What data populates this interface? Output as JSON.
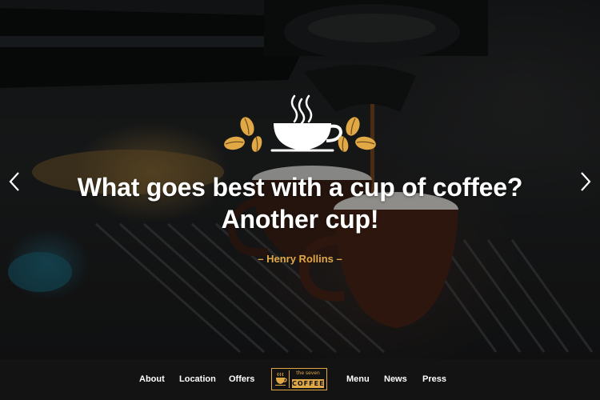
{
  "hero": {
    "quote_line1": "What goes best with a cup of coffee?",
    "quote_line2": "Another cup!",
    "author": "– Henry Rollins –",
    "logo_icon": "coffee-cup-with-beans-icon",
    "prev_icon": "chevron-left-icon",
    "next_icon": "chevron-right-icon"
  },
  "nav": {
    "left_items": [
      "About",
      "Location",
      "Offers"
    ],
    "right_items": [
      "Menu",
      "News",
      "Press"
    ],
    "brand_top": "the seven",
    "brand_word": "COFFEE",
    "brand_icon": "coffee-cup-icon"
  },
  "colors": {
    "accent": "#e0a945",
    "navbar_bg": "#131313",
    "text": "#ffffff"
  }
}
